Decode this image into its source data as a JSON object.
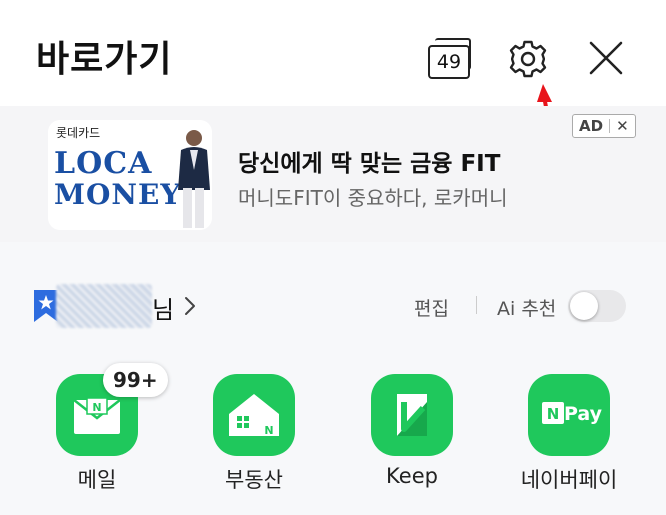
{
  "header": {
    "title": "바로가기",
    "tab_count": "49"
  },
  "ad": {
    "brand": "롯데카드",
    "logo_line1": "LOCA",
    "logo_line2": "MONEY",
    "headline": "당신에게 딱 맞는 금융 FIT",
    "subtext": "머니도FIT이 중요하다, 로카머니",
    "badge_label": "AD",
    "badge_close": "✕"
  },
  "user": {
    "suffix": "님",
    "edit_label": "편집",
    "ai_label": "Ai 추천",
    "ai_toggle_on": false
  },
  "apps": [
    {
      "label": "메일",
      "badge": "99+",
      "icon": "mail-icon"
    },
    {
      "label": "부동산",
      "icon": "house-icon"
    },
    {
      "label": "Keep",
      "icon": "keep-icon"
    },
    {
      "label": "네이버페이",
      "icon": "npay-icon",
      "icon_text": "Pay"
    }
  ],
  "colors": {
    "accent_green": "#1fc85c",
    "annotation_arrow": "#e8141b"
  }
}
